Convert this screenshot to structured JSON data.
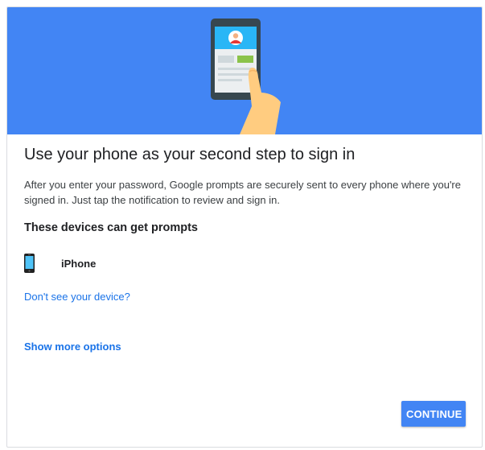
{
  "colors": {
    "hero_background": "#4285f4",
    "primary_button": "#4285f4",
    "link": "#1a73e8"
  },
  "hero": {
    "illustration": "hand-tapping-phone-icon"
  },
  "content": {
    "title": "Use your phone as your second step to sign in",
    "description": "After you enter your password, Google prompts are securely sent to every phone where you're signed in. Just tap the notification to review and sign in.",
    "devices_heading": "These devices can get prompts",
    "devices": [
      {
        "icon": "smartphone-icon",
        "name": "iPhone"
      }
    ],
    "missing_device_link": "Don't see your device?",
    "more_options_link": "Show more options"
  },
  "actions": {
    "continue_label": "CONTINUE"
  }
}
